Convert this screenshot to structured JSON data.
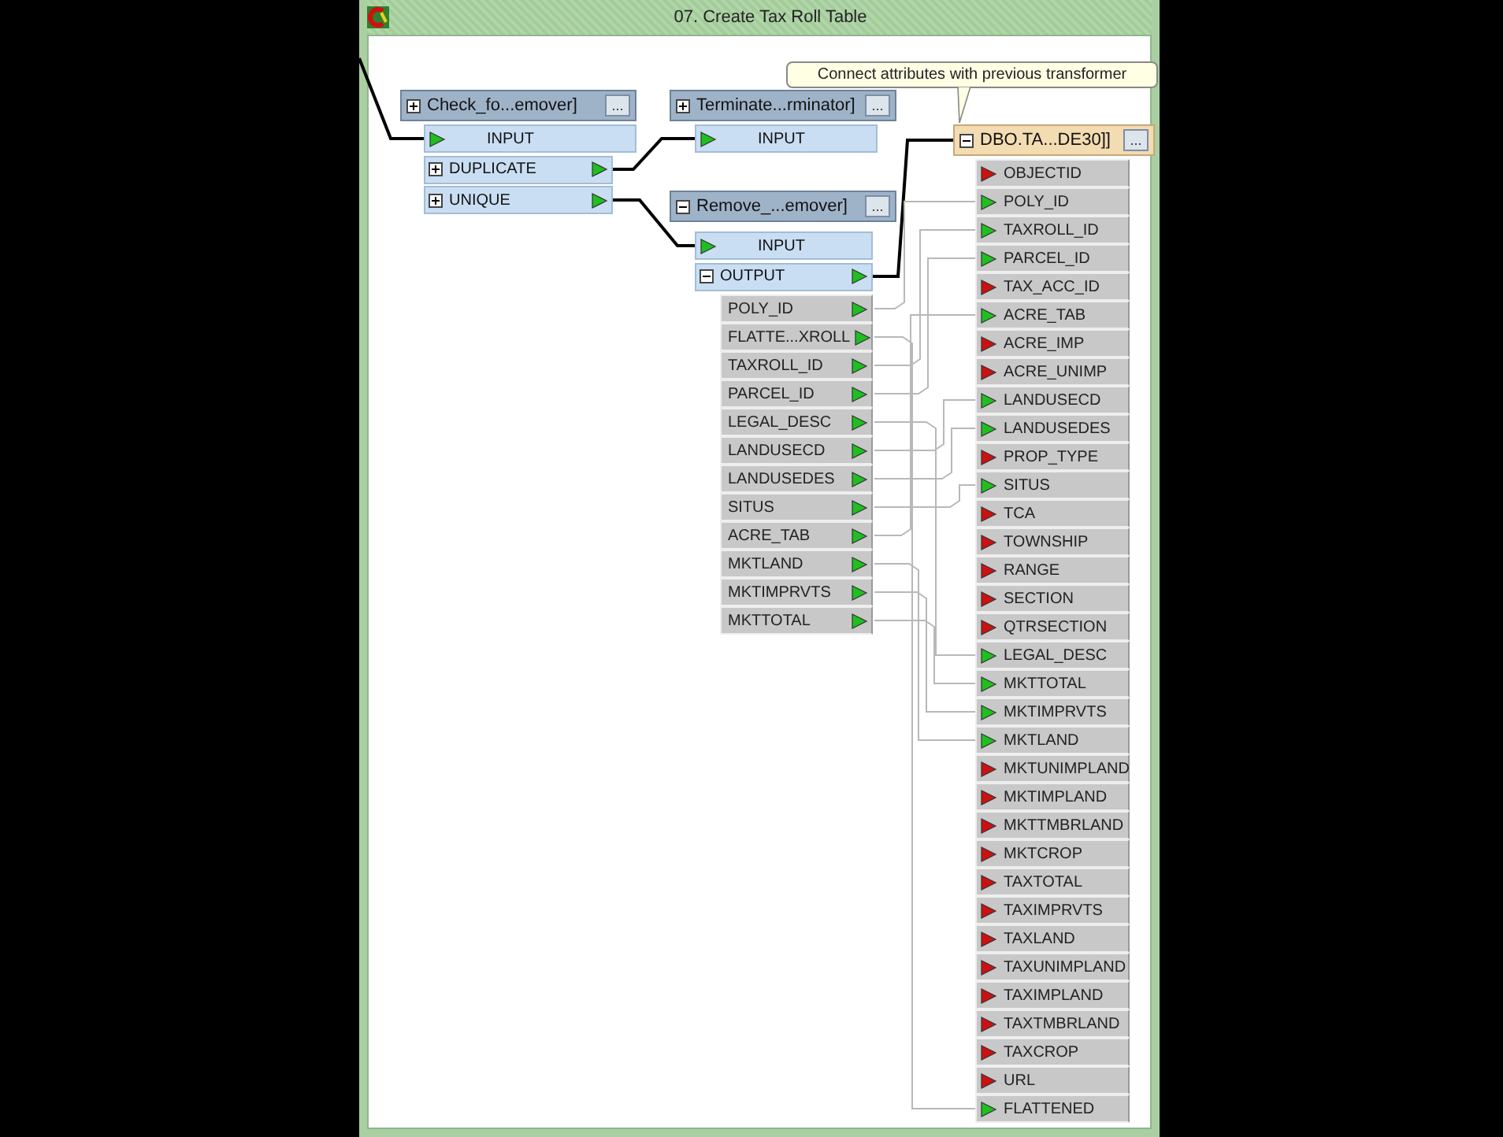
{
  "window": {
    "title": "07. Create Tax Roll Table"
  },
  "tooltip": {
    "text": "Connect attributes with previous transformer"
  },
  "nodes": [
    {
      "kind": "transformer",
      "title": "Check_fo...emover]",
      "expanded": false,
      "menu_button": "...",
      "ports": [
        {
          "kind": "input",
          "label": "INPUT",
          "connected": true
        },
        {
          "kind": "output",
          "label": "DUPLICATE",
          "expanded": false,
          "connected": true
        },
        {
          "kind": "output",
          "label": "UNIQUE",
          "expanded": false,
          "connected": true
        }
      ]
    },
    {
      "kind": "transformer",
      "title": "Terminate...rminator]",
      "expanded": false,
      "menu_button": "...",
      "ports": [
        {
          "kind": "input",
          "label": "INPUT",
          "connected": true
        }
      ]
    },
    {
      "kind": "transformer",
      "title": "Remove_...emover]",
      "expanded": true,
      "menu_button": "...",
      "ports": [
        {
          "kind": "input",
          "label": "INPUT",
          "connected": true
        },
        {
          "kind": "output",
          "label": "OUTPUT",
          "expanded": true,
          "connected": true,
          "attributes": [
            {
              "label": "POLY_ID",
              "connected": true
            },
            {
              "label": "FLATTE...XROLL",
              "connected": true
            },
            {
              "label": "TAXROLL_ID",
              "connected": true
            },
            {
              "label": "PARCEL_ID",
              "connected": true
            },
            {
              "label": "LEGAL_DESC",
              "connected": true
            },
            {
              "label": "LANDUSECD",
              "connected": true
            },
            {
              "label": "LANDUSEDES",
              "connected": true
            },
            {
              "label": "SITUS",
              "connected": true
            },
            {
              "label": "ACRE_TAB",
              "connected": true
            },
            {
              "label": "MKTLAND",
              "connected": true
            },
            {
              "label": "MKTIMPRVTS",
              "connected": true
            },
            {
              "label": "MKTTOTAL",
              "connected": true
            }
          ]
        }
      ]
    },
    {
      "kind": "feature_type",
      "title": "DBO.TA...DE30]]",
      "expanded": true,
      "menu_button": "...",
      "attributes": [
        {
          "label": "OBJECTID",
          "connected": false
        },
        {
          "label": "POLY_ID",
          "connected": true
        },
        {
          "label": "TAXROLL_ID",
          "connected": true
        },
        {
          "label": "PARCEL_ID",
          "connected": true
        },
        {
          "label": "TAX_ACC_ID",
          "connected": false
        },
        {
          "label": "ACRE_TAB",
          "connected": true
        },
        {
          "label": "ACRE_IMP",
          "connected": false
        },
        {
          "label": "ACRE_UNIMP",
          "connected": false
        },
        {
          "label": "LANDUSECD",
          "connected": true
        },
        {
          "label": "LANDUSEDES",
          "connected": true
        },
        {
          "label": "PROP_TYPE",
          "connected": false
        },
        {
          "label": "SITUS",
          "connected": true
        },
        {
          "label": "TCA",
          "connected": false
        },
        {
          "label": "TOWNSHIP",
          "connected": false
        },
        {
          "label": "RANGE",
          "connected": false
        },
        {
          "label": "SECTION",
          "connected": false
        },
        {
          "label": "QTRSECTION",
          "connected": false
        },
        {
          "label": "LEGAL_DESC",
          "connected": true
        },
        {
          "label": "MKTTOTAL",
          "connected": true
        },
        {
          "label": "MKTIMPRVTS",
          "connected": true
        },
        {
          "label": "MKTLAND",
          "connected": true
        },
        {
          "label": "MKTUNIMPLAND",
          "connected": false
        },
        {
          "label": "MKTIMPLAND",
          "connected": false
        },
        {
          "label": "MKTTMBRLAND",
          "connected": false
        },
        {
          "label": "MKTCROP",
          "connected": false
        },
        {
          "label": "TAXTOTAL",
          "connected": false
        },
        {
          "label": "TAXIMPRVTS",
          "connected": false
        },
        {
          "label": "TAXLAND",
          "connected": false
        },
        {
          "label": "TAXUNIMPLAND",
          "connected": false
        },
        {
          "label": "TAXIMPLAND",
          "connected": false
        },
        {
          "label": "TAXTMBRLAND",
          "connected": false
        },
        {
          "label": "TAXCROP",
          "connected": false
        },
        {
          "label": "URL",
          "connected": false
        },
        {
          "label": "FLATTENED",
          "connected": true
        }
      ]
    }
  ]
}
